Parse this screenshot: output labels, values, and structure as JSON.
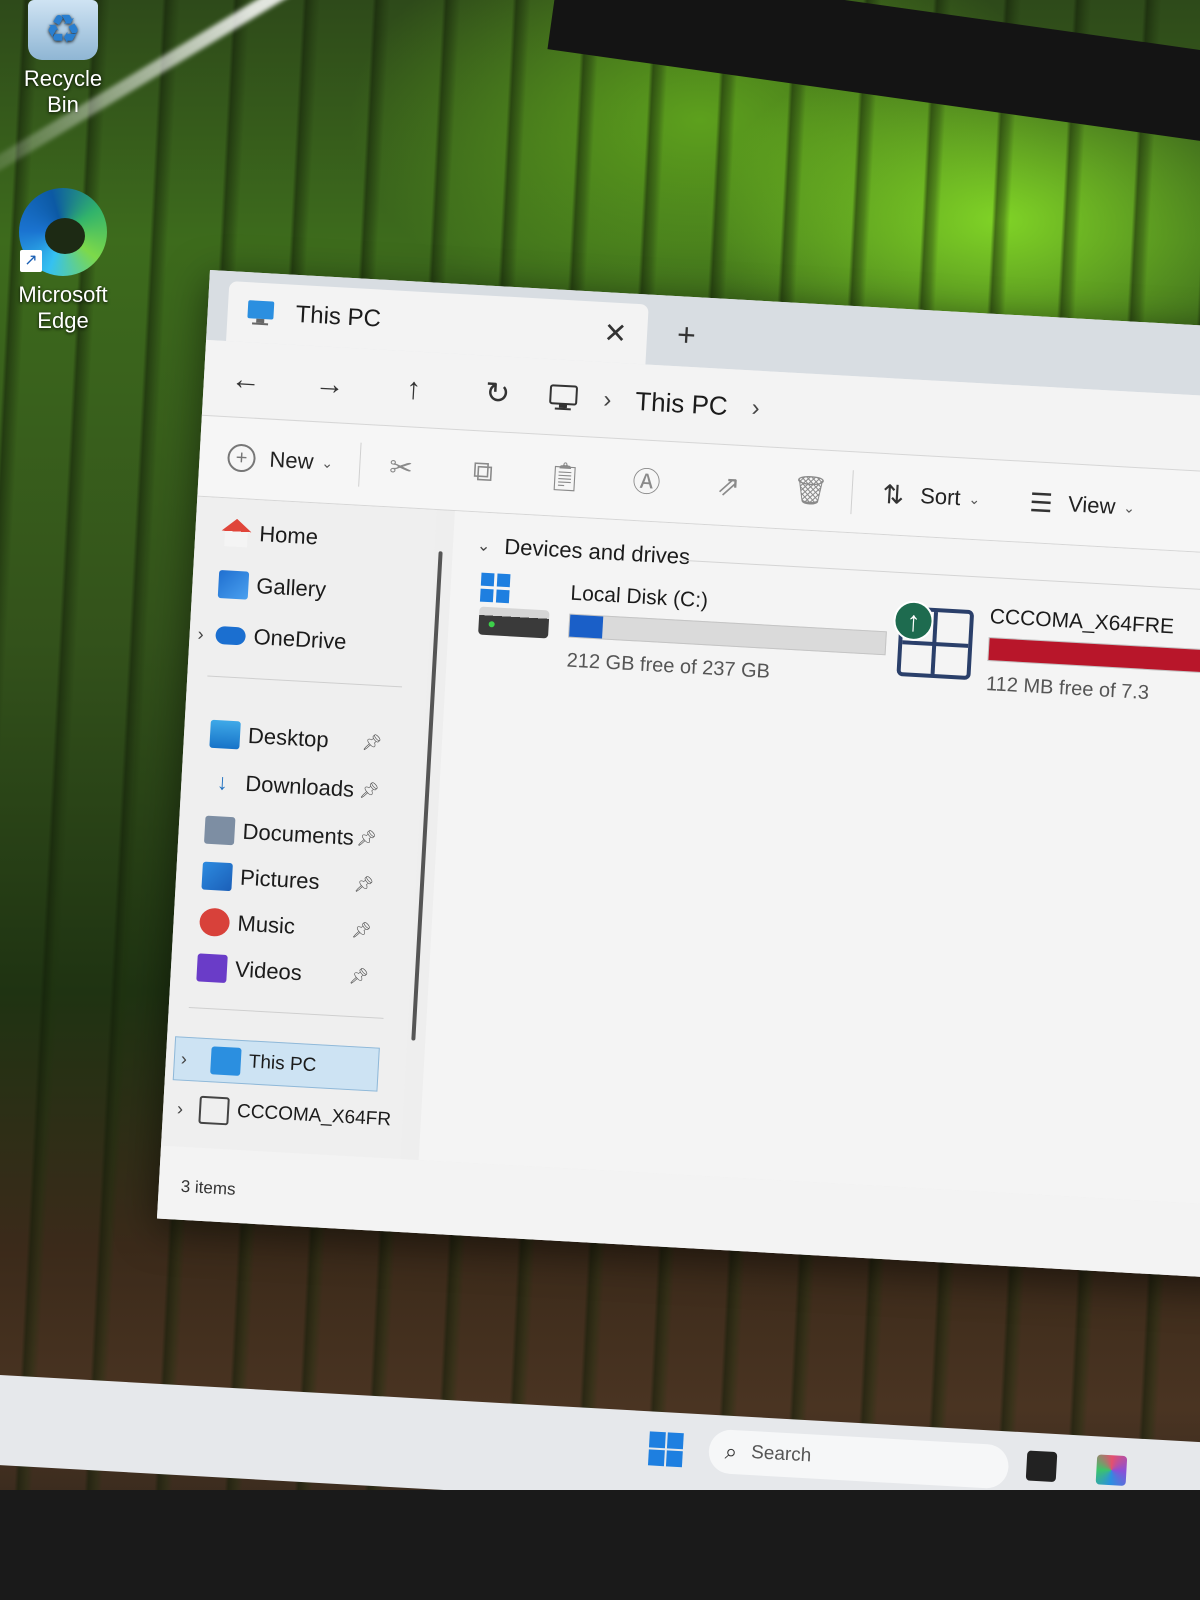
{
  "desktop": {
    "icons": [
      {
        "label": "Recycle Bin",
        "icon": "recycle-bin-icon"
      },
      {
        "label": "Microsoft Edge",
        "icon": "edge-icon"
      }
    ]
  },
  "window": {
    "tab": {
      "title": "This PC",
      "close_symbol": "✕",
      "new_tab_symbol": "+"
    },
    "nav": {
      "back": "←",
      "forward": "→",
      "up": "↑",
      "refresh": "↻",
      "breadcrumb": [
        "This PC"
      ],
      "sep": "›"
    },
    "toolbar": {
      "new_label": "New",
      "icons": [
        "cut-icon",
        "copy-icon",
        "paste-icon",
        "rename-icon",
        "share-icon",
        "delete-icon"
      ],
      "sort_label": "Sort",
      "view_label": "View"
    },
    "sidebar": {
      "items": [
        {
          "label": "Home",
          "icon": "home-icon"
        },
        {
          "label": "Gallery",
          "icon": "gallery-icon"
        },
        {
          "label": "OneDrive",
          "icon": "onedrive-icon"
        },
        {
          "label": "Desktop",
          "icon": "desktop-icon",
          "pinned": true
        },
        {
          "label": "Downloads",
          "icon": "downloads-icon",
          "pinned": true
        },
        {
          "label": "Documents",
          "icon": "documents-icon",
          "pinned": true
        },
        {
          "label": "Pictures",
          "icon": "pictures-icon",
          "pinned": true
        },
        {
          "label": "Music",
          "icon": "music-icon",
          "pinned": true
        },
        {
          "label": "Videos",
          "icon": "videos-icon",
          "pinned": true
        },
        {
          "label": "This PC",
          "icon": "this-pc-icon",
          "selected": true
        },
        {
          "label": "CCCOMA_X64FR",
          "icon": "usb-drive-icon"
        }
      ]
    },
    "content": {
      "group_title": "Devices and drives",
      "drives": [
        {
          "name": "Local Disk (C:)",
          "free_text": "212 GB free of 237 GB",
          "used_fraction": 0.105,
          "bar_color": "#1a5fc8"
        },
        {
          "name": "CCCOMA_X64FRE",
          "free_text": "112 MB free of 7.3",
          "used_fraction": 0.985,
          "bar_color": "#b8162a"
        }
      ]
    },
    "status": {
      "items": "3 items"
    }
  },
  "taskbar": {
    "search_placeholder": "Search"
  }
}
